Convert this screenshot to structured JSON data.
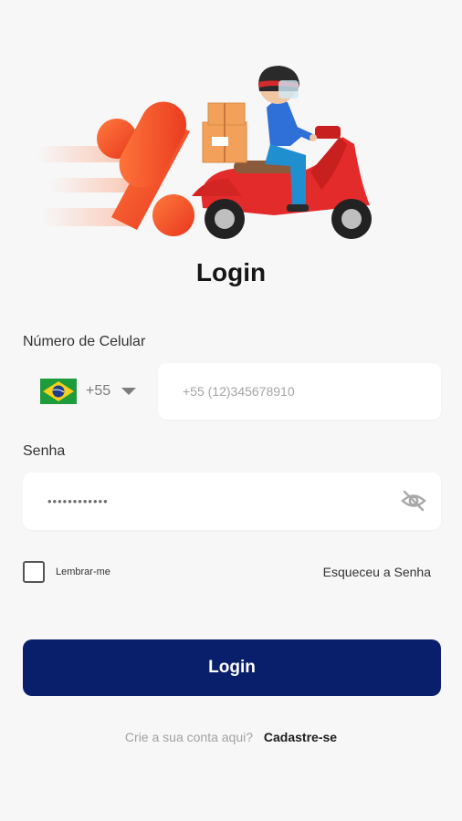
{
  "header": {
    "title": "Login"
  },
  "phone": {
    "label": "Número de Celular",
    "country_code": "+55",
    "country_flag": "brazil-flag-icon",
    "placeholder": "+55 (12)345678910"
  },
  "password": {
    "label": "Senha",
    "value": "••••••••••••",
    "toggle_icon": "eye-off-icon"
  },
  "options": {
    "remember_label": "Lembrar-me",
    "forgot_label": "Esqueceu a Senha"
  },
  "actions": {
    "login_label": "Login"
  },
  "signup": {
    "question": "Crie a sua conta aqui?",
    "link_label": "Cadastre-se"
  },
  "colors": {
    "primary": "#0a1f6b",
    "brand_orange": "#f25a22",
    "background": "#f7f7f8"
  }
}
